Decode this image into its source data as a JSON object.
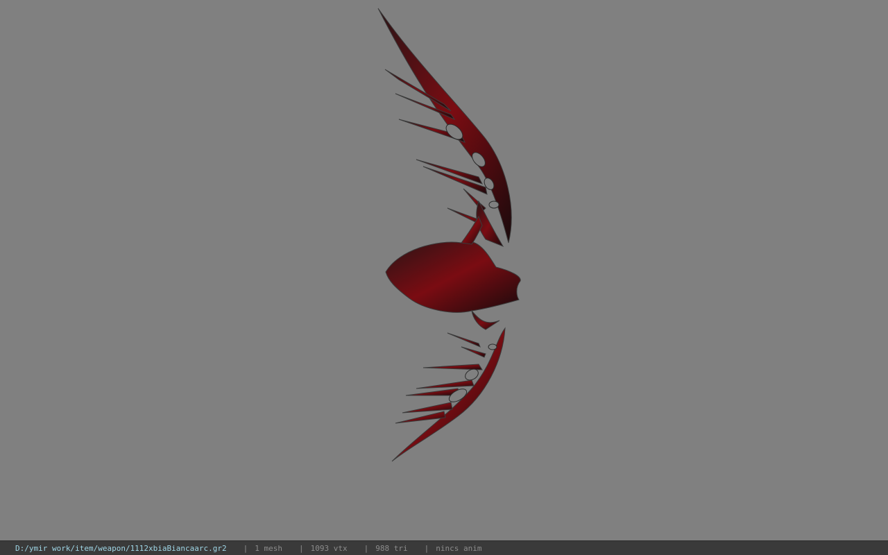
{
  "viewport": {
    "background_color": "#808080",
    "model": {
      "icon": "bow-model",
      "colors": {
        "base": "#1a0c0e",
        "accent": "#8a0d14",
        "highlight": "#5b5b5b"
      }
    }
  },
  "status_bar": {
    "path": "D:/ymir work/item/weapon/1112xbiaBiancaarc.gr2",
    "separator": "|",
    "mesh": "1 mesh",
    "vertices": "1093 vtx",
    "triangles": "988 tri",
    "animation": "nincs anim",
    "colors": {
      "background": "#3a3a3a",
      "path": "#9fd6e6",
      "text": "#8c8c8c"
    }
  }
}
